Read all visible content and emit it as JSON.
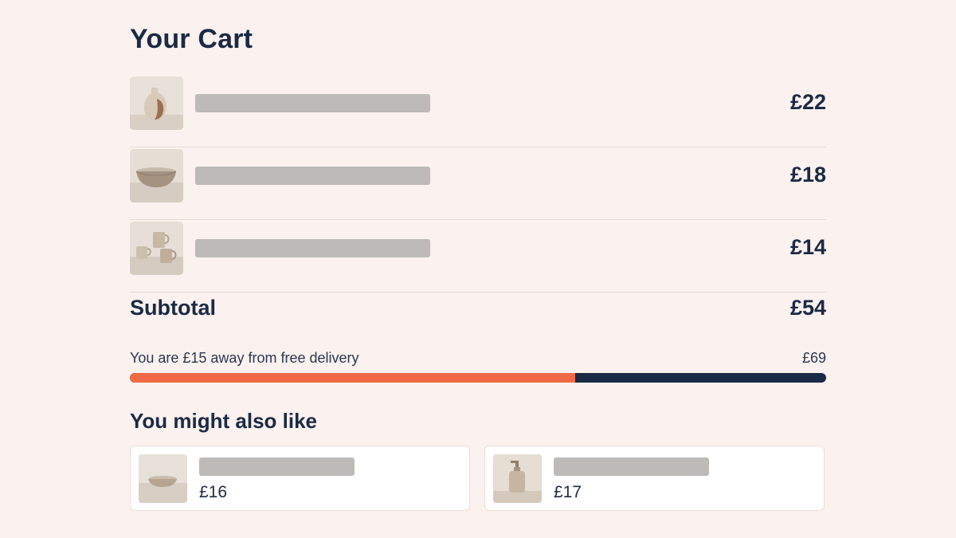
{
  "cart": {
    "title": "Your Cart",
    "items": [
      {
        "price": "£22",
        "image": "vase-image"
      },
      {
        "price": "£18",
        "image": "bowl-image"
      },
      {
        "price": "£14",
        "image": "mugs-image"
      }
    ],
    "subtotal_label": "Subtotal",
    "subtotal_value": "£54"
  },
  "delivery": {
    "message": "You are £15 away from free delivery",
    "threshold": "£69",
    "progress_fraction": 0.64,
    "colors": {
      "fill": "#f06a45",
      "track": "#1b2a45"
    }
  },
  "recommendations": {
    "title": "You might also like",
    "items": [
      {
        "price": "£16",
        "image": "dish-image"
      },
      {
        "price": "£17",
        "image": "soap-dispenser-image"
      }
    ]
  }
}
